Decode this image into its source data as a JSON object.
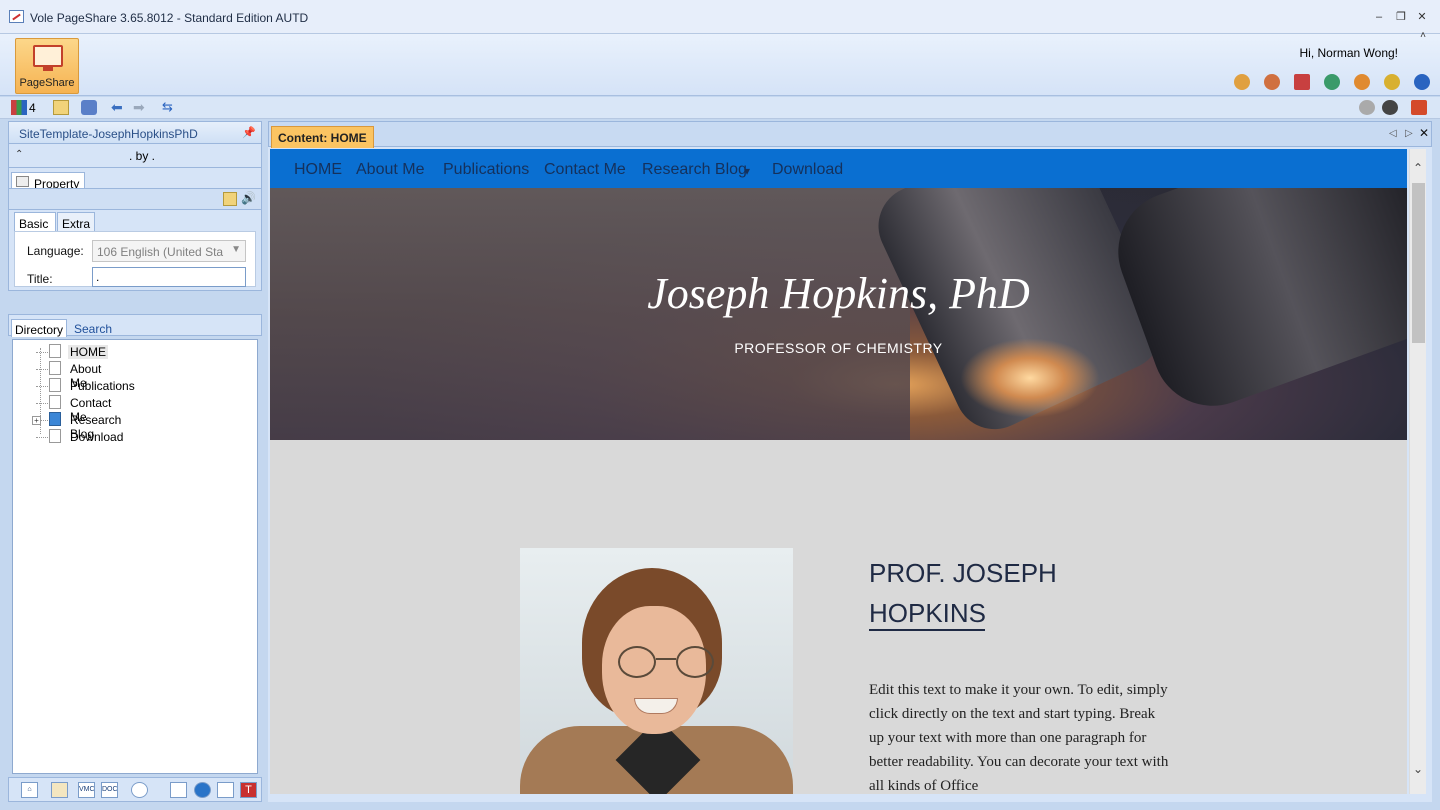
{
  "window": {
    "title": "Vole PageShare  3.65.8012 - Standard Edition AUTD",
    "minimize": "–",
    "restore": "❐",
    "close": "✕"
  },
  "ribbon": {
    "pageshare_label": "PageShare",
    "greeting": "Hi, Norman Wong!",
    "collapse": "˄"
  },
  "quick_toolbar": {
    "count": "4"
  },
  "left_panel": {
    "header": "SiteTemplate-JosephHopkinsPhD",
    "pin": "ᵖ",
    "by_text": ". by .",
    "property_tab": "Property",
    "basic_tab": "Basic",
    "extra_tab": "Extra",
    "language_label": "Language:",
    "language_value": "106 English (United Sta",
    "title_label": "Title:",
    "title_value": ".",
    "directory_tab": "Directory",
    "search_tab": "Search",
    "tree": [
      "HOME",
      "About Me",
      "Publications",
      "Contact Me",
      "Research Blog",
      "Download"
    ]
  },
  "content_tab": {
    "label": "Content: HOME"
  },
  "site": {
    "nav": [
      "HOME",
      "About Me",
      "Publications",
      "Contact Me",
      "Research Blog",
      "Download"
    ],
    "nav_dropdown_marker": "▾",
    "hero_title": "Joseph Hopkins, PhD",
    "hero_subtitle": "PROFESSOR OF CHEMISTRY",
    "heading_line1": "PROF. JOSEPH",
    "heading_line2": "HOPKINS",
    "body_text": "Edit this text to make it your own. To edit, simply click directly on the text and start typing. Break up your text with more than one paragraph for better readability. You can decorate your text with all kinds of Office"
  },
  "bottom_bar": [
    "VMC",
    "DOC"
  ]
}
